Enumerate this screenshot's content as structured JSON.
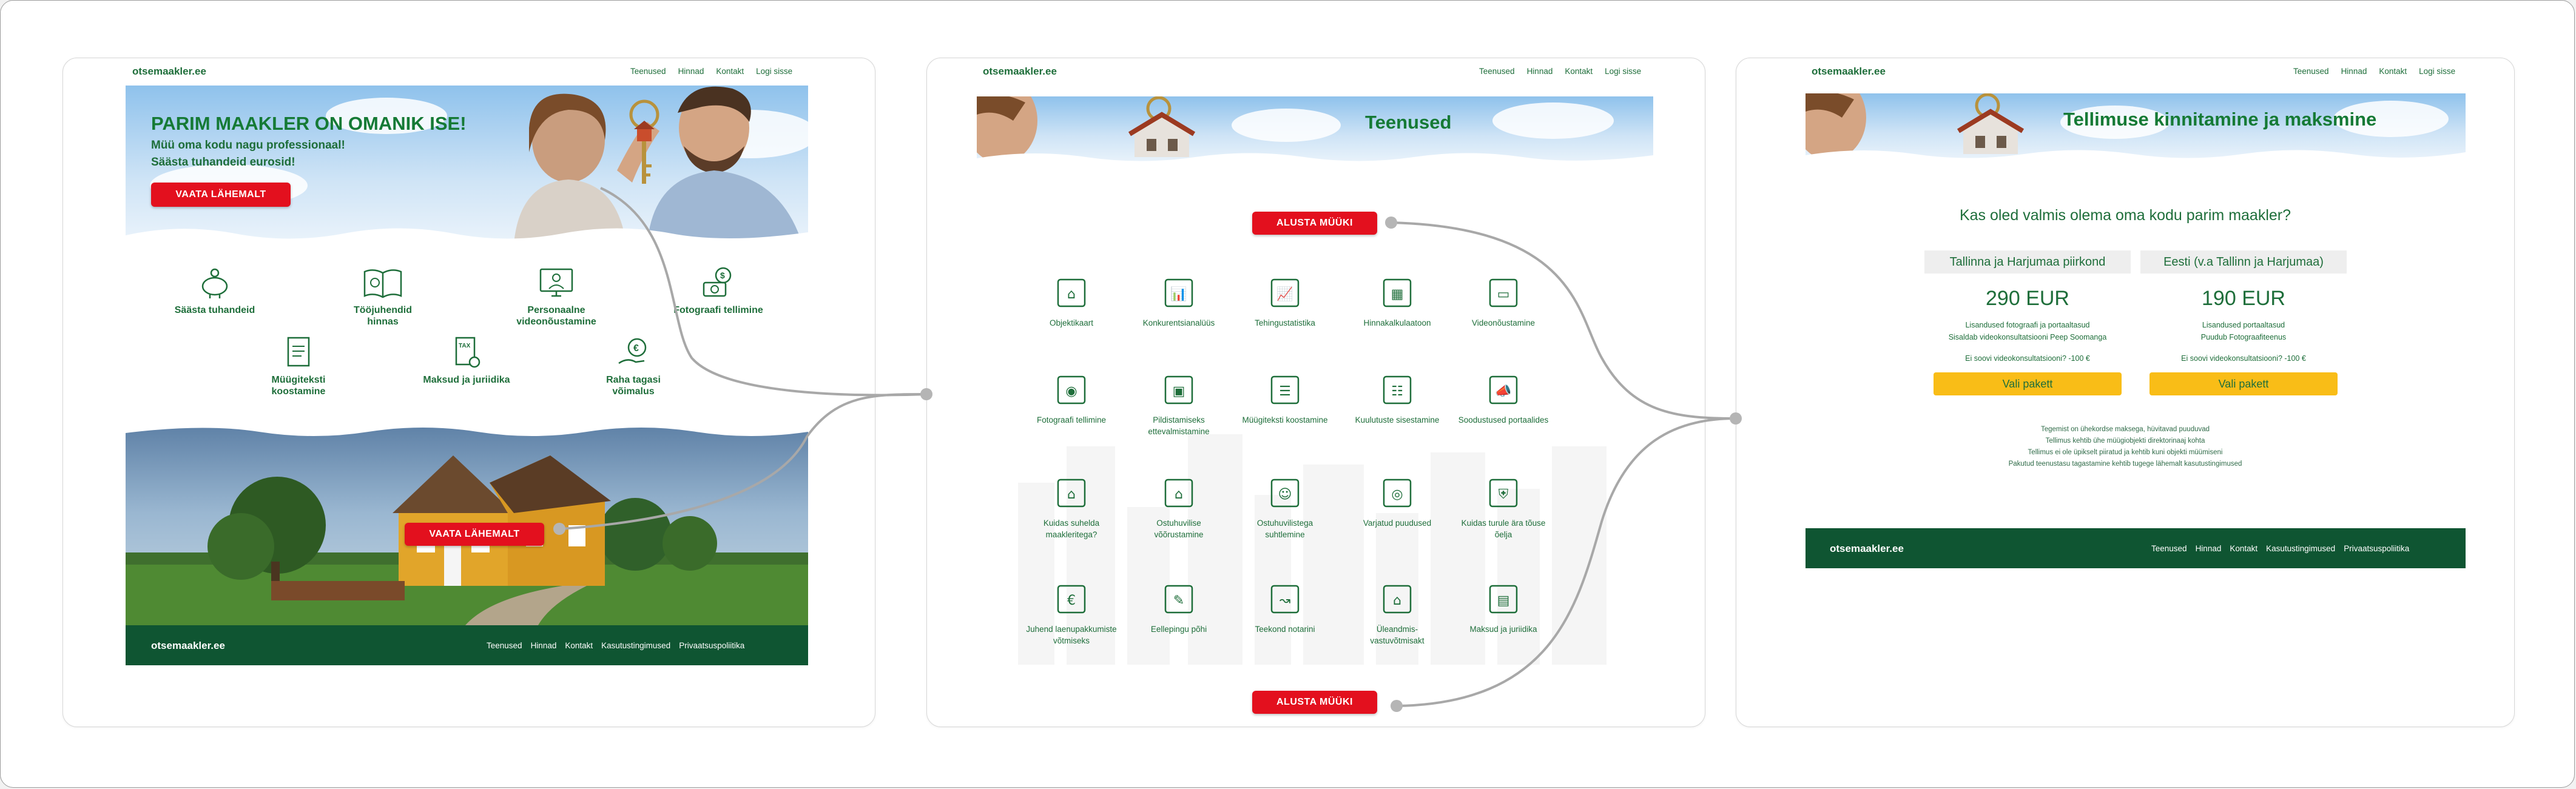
{
  "colors": {
    "brand_green": "#1e6e3a",
    "footer_green": "#0f5532",
    "cta_red": "#e3101e",
    "plan_yellow": "#f9bd17"
  },
  "home": {
    "logo": "otsemaakler.ee",
    "nav": [
      "Teenused",
      "Hinnad",
      "Kontakt",
      "Logi sisse"
    ],
    "hero_title": "PARIM MAAKLER ON OMANIK ISE!",
    "hero_line1": "Müü oma kodu nagu professionaal!",
    "hero_line2": "Säästa tuhandeid eurosid!",
    "hero_button": "VAATA LÄHEMALT",
    "features": [
      {
        "label": "Säästa tuhandeid",
        "icon": "piggy-bank-icon"
      },
      {
        "label": "Tööjuhendid hinnas",
        "icon": "book-icon"
      },
      {
        "label": "Personaalne videonõustamine",
        "icon": "video-consultation-icon"
      },
      {
        "label": "Fotograafi tellimine",
        "icon": "photographer-icon"
      },
      {
        "label": "Müügiteksti koostamine",
        "icon": "document-icon"
      },
      {
        "label": "Maksud ja juriidika",
        "icon": "tax-icon"
      },
      {
        "label": "Raha tagasi võimalus",
        "icon": "money-back-icon"
      }
    ],
    "house_button": "VAATA LÄHEMALT",
    "footer_logo": "otsemaakler.ee",
    "footer_nav": [
      "Teenused",
      "Hinnad",
      "Kontakt",
      "Kasutustingimused",
      "Privaatsuspoliitika"
    ]
  },
  "services": {
    "logo": "otsemaakler.ee",
    "nav": [
      "Teenused",
      "Hinnad",
      "Kontakt",
      "Logi sisse"
    ],
    "title": "Teenused",
    "start_button": "ALUSTA MÜÜKI",
    "items": [
      {
        "label": "Objektikaart",
        "icon": "house-person-icon"
      },
      {
        "label": "Konkurentsianalüüs",
        "icon": "analysis-chart-icon"
      },
      {
        "label": "Tehingustatistika",
        "icon": "statistics-icon"
      },
      {
        "label": "Hinnakalkulaatoon",
        "icon": "calculator-icon"
      },
      {
        "label": "Videonõustamine",
        "icon": "video-advice-icon"
      },
      {
        "label": "Fotograafi tellimine",
        "icon": "camera-person-icon"
      },
      {
        "label": "Pildistamiseks ettevalmistamine",
        "icon": "photo-prep-icon"
      },
      {
        "label": "Müügiteksti koostamine",
        "icon": "text-document-icon"
      },
      {
        "label": "Kuulutuste sisestamine",
        "icon": "listing-icon"
      },
      {
        "label": "Soodustused portaalides",
        "icon": "discount-megaphone-icon"
      },
      {
        "label": "Kuidas suhelda maakleritega?",
        "icon": "broker-chat-icon"
      },
      {
        "label": "Ostuhuvilise võõrustamine",
        "icon": "host-buyer-icon"
      },
      {
        "label": "Ostuhuvilistega suhtlemine",
        "icon": "buyer-chat-icon"
      },
      {
        "label": "Varjatud puudused",
        "icon": "hidden-defects-icon"
      },
      {
        "label": "Kuidas turule ära tõuse õelja",
        "icon": "shield-check-icon"
      },
      {
        "label": "Juhend laenupakkumiste võtmiseks",
        "icon": "loan-bag-icon"
      },
      {
        "label": "Eellepingu põhi",
        "icon": "contract-pen-icon"
      },
      {
        "label": "Teekond notarini",
        "icon": "route-icon"
      },
      {
        "label": "Üleandmis-vastuvõtmisakt",
        "icon": "handover-icon"
      },
      {
        "label": "Maksud ja juriidika",
        "icon": "tax-law-icon"
      }
    ]
  },
  "checkout": {
    "logo": "otsemaakler.ee",
    "nav": [
      "Teenused",
      "Hinnad",
      "Kontakt",
      "Logi sisse"
    ],
    "title": "Tellimuse kinnitamine ja maksmine",
    "question": "Kas oled valmis olema oma kodu parim maakler?",
    "plans": [
      {
        "region": "Tallinna ja Harjumaa piirkond",
        "price": "290 EUR",
        "feature1": "Lisandused fotograafi ja portaaltasud",
        "feature2": "Sisaldab videokonsultatsiooni Peep Soomanga",
        "video_option": "Ei soovi videokonsultatsiooni? -100 €",
        "button": "Vali pakett"
      },
      {
        "region": "Eesti (v.a Tallinn ja Harjumaa)",
        "price": "190 EUR",
        "feature1": "Lisandused portaaltasud",
        "feature2": "Puudub Fotograafiteenus",
        "video_option": "Ei soovi videokonsultatsiooni? -100 €",
        "button": "Vali pakett"
      }
    ],
    "notes": [
      "Tegemist on ühekordse maksega, hüvitavad puuduvad",
      "Tellimus kehtib ühe müügiobjekti direktorinaaj kohta",
      "Tellimus ei ole üpikselt piiratud ja kehtib kuni objekti müümiseni",
      "Pakutud teenustasu tagastamine kehtib tugege lähemalt kasutustingimused"
    ],
    "footer_logo": "otsemaakler.ee",
    "footer_nav": [
      "Teenused",
      "Hinnad",
      "Kontakt",
      "Kasutustingimused",
      "Privaatsuspoliitika"
    ]
  }
}
